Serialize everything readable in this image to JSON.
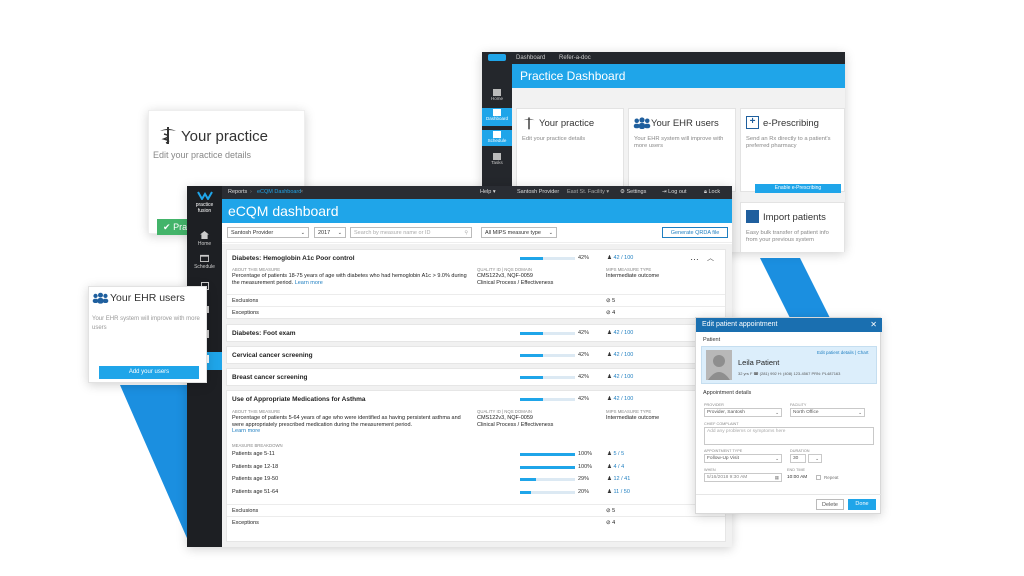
{
  "back_practice_card": {
    "title": "Your practice",
    "description": "Edit your practice details",
    "button_label": "Pra"
  },
  "back_dashboard": {
    "topnav": [
      "Dashboard",
      "Refer-a-doc"
    ],
    "title": "Practice Dashboard",
    "sidebar": [
      "Home",
      "Dashboard",
      "Schedule",
      "Tasks"
    ],
    "tiles": {
      "practice": {
        "title": "Your practice",
        "description": "Edit your practice details"
      },
      "ehr": {
        "title": "Your EHR users",
        "description": "Your EHR system will improve with more users"
      },
      "erx": {
        "title": "e-Prescribing",
        "description": "Send an Rx directly to a patient's preferred pharmacy",
        "button": "Enable e-Prescribing"
      },
      "import": {
        "title": "Import patients",
        "description": "Easy bulk transfer of patient info from your previous system"
      }
    }
  },
  "ehr_card": {
    "title": "Your EHR users",
    "description": "Your EHR system will improve with more users",
    "button_label": "Add your users"
  },
  "main": {
    "logo_line1": "practice",
    "logo_line2": "fusion",
    "sidebar": [
      "Home",
      "Schedule"
    ],
    "breadcrumb": {
      "root": "Reports",
      "current": "eCQM Dashboard"
    },
    "topbar": {
      "help": "Help",
      "user": "Santosh Provider",
      "facility": "East St. Facility",
      "settings": "Settings",
      "logout": "Log out",
      "lock": "Lock"
    },
    "title": "eCQM dashboard",
    "filters": {
      "provider": "Santosh Provider",
      "year": "2017",
      "search_placeholder": "Search by measure name or ID",
      "measure_type": "All MIPS measure type",
      "generate_button": "Generate QRDA file"
    },
    "labels": {
      "about": "ABOUT THIS MEASURE",
      "quality_id": "QUALITY ID  |  NQS DOMAIN",
      "mips_type": "MIPS MEASURE TYPE",
      "breakdown": "MEASURE BREAKDOWN",
      "exclusions": "Exclusions",
      "exceptions": "Exceptions",
      "learn_more": "Learn more"
    },
    "measures": [
      {
        "name": "Diabetes: Hemoglobin A1c Poor control",
        "percent": "42%",
        "fraction": 0.42,
        "count": "42 / 100",
        "about": "Percentage of patients 18-75 years of age with diabetes who had hemoglobin A1c > 9.0% during the measurement period.",
        "quality_id": "CMS122v3, NQF-0059",
        "domain": "Clinical Process / Effectiveness",
        "mips_type": "Intermediate outcome",
        "exclusions": "5",
        "exceptions": "4"
      },
      {
        "name": "Diabetes: Foot exam",
        "percent": "42%",
        "fraction": 0.42,
        "count": "42 / 100"
      },
      {
        "name": "Cervical cancer screening",
        "percent": "42%",
        "fraction": 0.42,
        "count": "42 / 100"
      },
      {
        "name": "Breast cancer screening",
        "percent": "42%",
        "fraction": 0.42,
        "count": "42 / 100"
      },
      {
        "name": "Use of Appropriate Medications for Asthma",
        "percent": "42%",
        "fraction": 0.42,
        "count": "42 / 100",
        "about": "Percentage of patients 5-64 years of age who were identified as having persistent asthma and were appropriately prescribed medication during the measurement period.",
        "quality_id": "CMS122v3, NQF-0059",
        "domain": "Clinical Process / Effectiveness",
        "mips_type": "Intermediate outcome",
        "breakdown": [
          {
            "label": "Patients age 5-11",
            "percent": "100%",
            "fraction": 1.0,
            "count": "5 / 5"
          },
          {
            "label": "Patients age 12-18",
            "percent": "100%",
            "fraction": 1.0,
            "count": "4 / 4"
          },
          {
            "label": "Patients age 19-50",
            "percent": "29%",
            "fraction": 0.29,
            "count": "12 / 41"
          },
          {
            "label": "Patients age 51-64",
            "percent": "20%",
            "fraction": 0.2,
            "count": "11 / 50"
          }
        ],
        "exclusions": "5",
        "exceptions": "4"
      }
    ]
  },
  "modal": {
    "title": "Edit patient appointment",
    "patient_section": "Patient",
    "patient_name": "Leila Patient",
    "patient_info": "32 yrs F   ☎ (281) 992   H: (408) 123-4567   PRN: PL487163",
    "patient_links": "Edit patient details  |  Chart",
    "appt_section": "Appointment details",
    "provider_label": "PROVIDER",
    "provider_value": "Provider, Santosh",
    "facility_label": "FACILITY",
    "facility_value": "North Office",
    "complaint_label": "CHIEF COMPLAINT",
    "complaint_placeholder": "Add any problems or symptoms here",
    "type_label": "APPOINTMENT TYPE",
    "type_value": "Follow-Up Visit",
    "duration_label": "DURATION",
    "duration_value": "30",
    "when_label": "WHEN",
    "when_value": "5/16/2018 9:30 AM",
    "end_label": "END TIME",
    "end_value": "10:00 AM",
    "repeat_label": "Repeat",
    "delete_button": "Delete",
    "done_button": "Done"
  },
  "colors": {
    "accent": "#1fa5e9",
    "dark_sidebar": "#1d1f23",
    "success": "#43b46a",
    "modal_header": "#1a6fb0"
  }
}
